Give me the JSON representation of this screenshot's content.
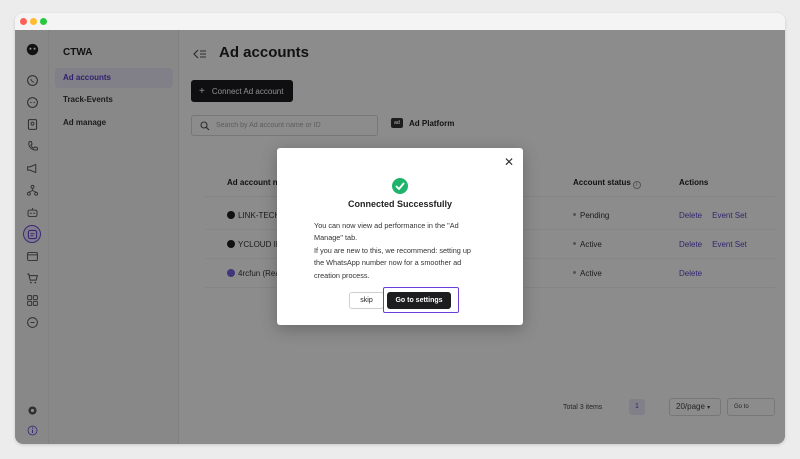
{
  "window": {
    "traffic_lights": [
      "close",
      "minimize",
      "zoom"
    ]
  },
  "rail": {
    "icons": [
      "logo-icon",
      "whatsapp-icon",
      "chat-icon",
      "contacts-icon",
      "phone-icon",
      "megaphone-icon",
      "flow-icon",
      "bot-icon",
      "ctwa-icon",
      "inbox-icon",
      "cart-icon",
      "apps-icon",
      "api-icon",
      "settings-icon",
      "info-icon"
    ],
    "active": "ctwa-icon"
  },
  "subnav": {
    "title": "CTWA",
    "items": [
      {
        "label": "Ad accounts",
        "active": true
      },
      {
        "label": "Track-Events",
        "active": false
      },
      {
        "label": "Ad manage",
        "active": false
      }
    ]
  },
  "main": {
    "title": "Ad accounts",
    "connect_button": "Connect Ad account",
    "search_placeholder": "Search by Ad account name or ID",
    "platform_label": "Ad Platform",
    "table": {
      "headers": {
        "name": "Ad account name",
        "status": "Account status",
        "actions": "Actions"
      },
      "rows": [
        {
          "name": "LINK-TECH_adv",
          "icon": "dark",
          "status": "Pending",
          "actions": [
            "Delete",
            "Event Set"
          ]
        },
        {
          "name": "YCLOUD INTERN",
          "icon": "dark",
          "status": "Active",
          "actions": [
            "Delete",
            "Event Set"
          ]
        },
        {
          "name": "4rcfun (Read-Or",
          "icon": "purple",
          "status": "Active",
          "actions": [
            "Delete"
          ]
        }
      ]
    },
    "pagination": {
      "total": "Total 3 items",
      "page": "1",
      "per_page": "20/page",
      "goto": "Go to"
    }
  },
  "modal": {
    "title": "Connected Successfully",
    "body_lines": [
      "You can now view ad performance in the \"Ad",
      "Manage\" tab.",
      "If you are new to this, we recommend: setting up",
      "the WhatsApp number now for a smoother ad",
      "creation process."
    ],
    "skip": "skip",
    "primary": "Go to settings"
  },
  "colors": {
    "accent": "#6a3fd9",
    "success": "#1fb36b",
    "dark_button": "#1d1d1f"
  }
}
